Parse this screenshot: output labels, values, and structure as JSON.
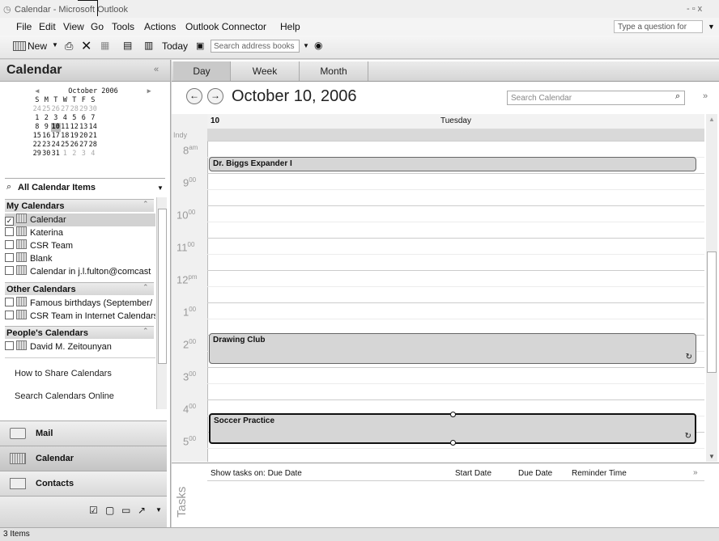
{
  "window": {
    "title": "Calendar - Microsoft Outlook",
    "controls": "- ▫ x"
  },
  "menu": {
    "file": "File",
    "edit": "Edit",
    "view": "View",
    "go": "Go",
    "tools": "Tools",
    "actions": "Actions",
    "connector": "Outlook Connector",
    "help": "Help",
    "help_placeholder": "Type a question for help"
  },
  "toolbar": {
    "new": "New",
    "today": "Today",
    "address_placeholder": "Search address books"
  },
  "nav": {
    "title": "Calendar",
    "mini": {
      "month": "October 2006",
      "weekdays": [
        "S",
        "M",
        "T",
        "W",
        "T",
        "F",
        "S"
      ],
      "weeks": [
        [
          "24",
          "25",
          "26",
          "27",
          "28",
          "29",
          "30"
        ],
        [
          "1",
          "2",
          "3",
          "4",
          "5",
          "6",
          "7"
        ],
        [
          "8",
          "9",
          "10",
          "11",
          "12",
          "13",
          "14"
        ],
        [
          "15",
          "16",
          "17",
          "18",
          "19",
          "20",
          "21"
        ],
        [
          "22",
          "23",
          "24",
          "25",
          "26",
          "27",
          "28"
        ],
        [
          "29",
          "30",
          "31",
          "1",
          "2",
          "3",
          "4"
        ]
      ]
    },
    "all_items": "All Calendar Items",
    "my_calendars": "My Calendars",
    "my": [
      "Calendar",
      "Katerina",
      "CSR Team",
      "Blank",
      "Calendar in j.l.fulton@comcast"
    ],
    "other_calendars": "Other Calendars",
    "other": [
      "Famous birthdays (September/",
      "CSR Team in Internet Calendars"
    ],
    "peoples_calendars": "People's Calendars",
    "people": [
      "David M. Zeitounyan"
    ],
    "share_link": "How to Share Calendars",
    "search_link": "Search Calendars Online",
    "mail": "Mail",
    "calendar": "Calendar",
    "contacts": "Contacts"
  },
  "view": {
    "tabs": [
      "Day",
      "Week",
      "Month"
    ],
    "date": "October 10, 2006",
    "search_placeholder": "Search Calendar",
    "day_num": "10",
    "day_name": "Tuesday",
    "tz": "Indy",
    "hours": [
      {
        "h": "8",
        "s": "am"
      },
      {
        "h": "9",
        "s": "00"
      },
      {
        "h": "10",
        "s": "00"
      },
      {
        "h": "11",
        "s": "00"
      },
      {
        "h": "12",
        "s": "pm"
      },
      {
        "h": "1",
        "s": "00"
      },
      {
        "h": "2",
        "s": "00"
      },
      {
        "h": "3",
        "s": "00"
      },
      {
        "h": "4",
        "s": "00"
      },
      {
        "h": "5",
        "s": "00"
      }
    ],
    "appointments": [
      "Dr. Biggs Expander I",
      "Drawing Club",
      "Soccer Practice"
    ]
  },
  "tasks": {
    "label": "Tasks",
    "show": "Show tasks on: Due Date",
    "start": "Start Date",
    "due": "Due Date",
    "reminder": "Reminder Time"
  },
  "status": {
    "items": "3 Items"
  }
}
